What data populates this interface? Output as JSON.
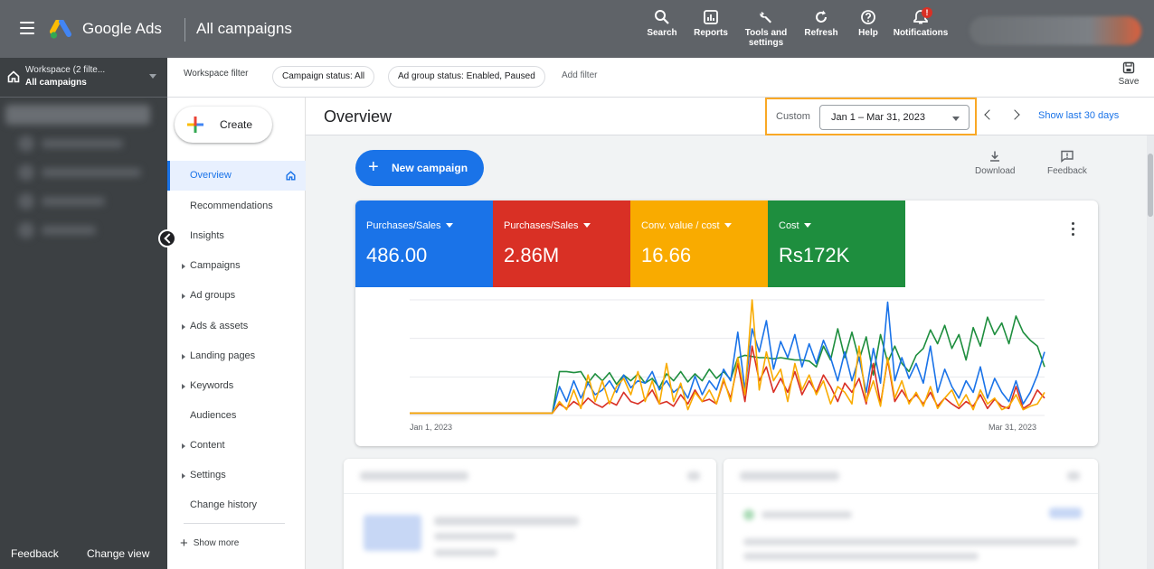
{
  "topbar": {
    "brand": "Google Ads",
    "page_title": "All campaigns",
    "tools": [
      {
        "label": "Search",
        "icon": "search-icon"
      },
      {
        "label": "Reports",
        "icon": "reports-icon"
      },
      {
        "label": "Tools and settings",
        "icon": "wrench-icon"
      },
      {
        "label": "Refresh",
        "icon": "refresh-icon"
      },
      {
        "label": "Help",
        "icon": "help-icon"
      },
      {
        "label": "Notifications",
        "icon": "bell-icon",
        "badge": "!"
      }
    ]
  },
  "workspace": {
    "line1": "Workspace (2 filte...",
    "line2": "All campaigns"
  },
  "filters": {
    "workspace_label": "Workspace filter",
    "chips": [
      "Campaign status: All",
      "Ad group status: Enabled, Paused"
    ],
    "add_filter": "Add filter",
    "save_label": "Save"
  },
  "subnav": {
    "create_label": "Create",
    "items": [
      {
        "label": "Overview",
        "active": true
      },
      {
        "label": "Recommendations"
      },
      {
        "label": "Insights"
      },
      {
        "label": "Campaigns",
        "expandable": true
      },
      {
        "label": "Ad groups",
        "expandable": true
      },
      {
        "label": "Ads & assets",
        "expandable": true
      },
      {
        "label": "Landing pages",
        "expandable": true
      },
      {
        "label": "Keywords",
        "expandable": true
      },
      {
        "label": "Audiences"
      },
      {
        "label": "Content",
        "expandable": true
      },
      {
        "label": "Settings",
        "expandable": true
      },
      {
        "label": "Change history"
      }
    ],
    "show_more": "Show more"
  },
  "footer": {
    "feedback": "Feedback",
    "change_view": "Change view"
  },
  "main": {
    "title": "Overview",
    "date_mode": "Custom",
    "date_range": "Jan 1 – Mar 31, 2023",
    "show_last": "Show last 30 days",
    "new_campaign": "New campaign",
    "download": "Download",
    "feedback": "Feedback"
  },
  "metrics": [
    {
      "label": "Purchases/Sales",
      "value": "486.00",
      "color": "#1a73e8"
    },
    {
      "label": "Purchases/Sales",
      "value": "2.86M",
      "color": "#d93025"
    },
    {
      "label": "Conv. value / cost",
      "value": "16.66",
      "color": "#f9ab00"
    },
    {
      "label": "Cost",
      "value": "Rs172K",
      "color": "#1e8e3e"
    }
  ],
  "chart_data": {
    "type": "line",
    "x_start_label": "Jan 1, 2023",
    "x_end_label": "Mar 31, 2023",
    "ylim": [
      0,
      1
    ],
    "grid": true,
    "series": [
      {
        "color": "#1e8e3e",
        "values": [
          0.02,
          0.02,
          0.02,
          0.02,
          0.02,
          0.02,
          0.02,
          0.02,
          0.02,
          0.02,
          0.02,
          0.02,
          0.02,
          0.02,
          0.02,
          0.02,
          0.02,
          0.02,
          0.02,
          0.02,
          0.02,
          0.38,
          0.38,
          0.37,
          0.38,
          0.28,
          0.36,
          0.3,
          0.37,
          0.27,
          0.35,
          0.3,
          0.36,
          0.28,
          0.32,
          0.24,
          0.36,
          0.3,
          0.38,
          0.29,
          0.36,
          0.3,
          0.4,
          0.32,
          0.38,
          0.31,
          0.5,
          0.52,
          0.51,
          0.5,
          0.5,
          0.49,
          0.5,
          0.49,
          0.48,
          0.48,
          0.47,
          0.42,
          0.6,
          0.48,
          0.75,
          0.5,
          0.72,
          0.48,
          0.68,
          0.35,
          0.7,
          0.46,
          0.6,
          0.45,
          0.38,
          0.52,
          0.58,
          0.74,
          0.62,
          0.78,
          0.58,
          0.7,
          0.48,
          0.76,
          0.6,
          0.85,
          0.7,
          0.8,
          0.62,
          0.86,
          0.72,
          0.65,
          0.6,
          0.42
        ]
      },
      {
        "color": "#1a73e8",
        "values": [
          0.02,
          0.02,
          0.02,
          0.02,
          0.02,
          0.02,
          0.02,
          0.02,
          0.02,
          0.02,
          0.02,
          0.02,
          0.02,
          0.02,
          0.02,
          0.02,
          0.02,
          0.02,
          0.02,
          0.02,
          0.02,
          0.25,
          0.12,
          0.3,
          0.15,
          0.28,
          0.18,
          0.22,
          0.3,
          0.2,
          0.35,
          0.24,
          0.3,
          0.28,
          0.38,
          0.22,
          0.3,
          0.2,
          0.25,
          0.15,
          0.34,
          0.18,
          0.3,
          0.22,
          0.4,
          0.3,
          0.72,
          0.22,
          0.75,
          0.55,
          0.82,
          0.4,
          0.64,
          0.5,
          0.7,
          0.42,
          0.62,
          0.45,
          0.65,
          0.5,
          0.3,
          0.55,
          0.3,
          0.5,
          0.2,
          0.58,
          0.28,
          0.98,
          0.3,
          0.5,
          0.32,
          0.45,
          0.28,
          0.6,
          0.2,
          0.4,
          0.25,
          0.15,
          0.3,
          0.2,
          0.42,
          0.15,
          0.32,
          0.2,
          0.12,
          0.3,
          0.1,
          0.2,
          0.35,
          0.55
        ]
      },
      {
        "color": "#d93025",
        "values": [
          0.02,
          0.02,
          0.02,
          0.02,
          0.02,
          0.02,
          0.02,
          0.02,
          0.02,
          0.02,
          0.02,
          0.02,
          0.02,
          0.02,
          0.02,
          0.02,
          0.02,
          0.02,
          0.02,
          0.02,
          0.02,
          0.1,
          0.06,
          0.12,
          0.08,
          0.15,
          0.1,
          0.07,
          0.12,
          0.09,
          0.2,
          0.12,
          0.1,
          0.14,
          0.22,
          0.1,
          0.12,
          0.08,
          0.18,
          0.1,
          0.22,
          0.12,
          0.14,
          0.1,
          0.3,
          0.15,
          0.45,
          0.12,
          0.6,
          0.3,
          0.42,
          0.2,
          0.32,
          0.2,
          0.38,
          0.18,
          0.3,
          0.2,
          0.35,
          0.25,
          0.12,
          0.28,
          0.2,
          0.32,
          0.1,
          0.45,
          0.1,
          0.48,
          0.12,
          0.22,
          0.12,
          0.18,
          0.1,
          0.2,
          0.08,
          0.15,
          0.1,
          0.06,
          0.12,
          0.08,
          0.18,
          0.06,
          0.14,
          0.08,
          0.06,
          0.25,
          0.06,
          0.1,
          0.22,
          0.15
        ]
      },
      {
        "color": "#f9ab00",
        "values": [
          0.02,
          0.02,
          0.02,
          0.02,
          0.02,
          0.02,
          0.02,
          0.02,
          0.02,
          0.02,
          0.02,
          0.02,
          0.02,
          0.02,
          0.02,
          0.02,
          0.02,
          0.02,
          0.02,
          0.02,
          0.02,
          0.12,
          0.05,
          0.22,
          0.06,
          0.35,
          0.12,
          0.3,
          0.1,
          0.25,
          0.32,
          0.18,
          0.38,
          0.12,
          0.3,
          0.1,
          0.45,
          0.12,
          0.28,
          0.05,
          0.2,
          0.12,
          0.22,
          0.1,
          0.32,
          0.12,
          0.5,
          0.18,
          1.0,
          0.22,
          0.55,
          0.3,
          0.4,
          0.12,
          0.45,
          0.22,
          0.35,
          0.18,
          0.3,
          0.1,
          0.25,
          0.2,
          0.1,
          0.6,
          0.12,
          0.3,
          0.08,
          0.5,
          0.15,
          0.3,
          0.1,
          0.2,
          0.08,
          0.25,
          0.06,
          0.15,
          0.22,
          0.08,
          0.18,
          0.05,
          0.22,
          0.1,
          0.15,
          0.05,
          0.08,
          0.18,
          0.05,
          0.08,
          0.1,
          0.2
        ]
      }
    ]
  }
}
